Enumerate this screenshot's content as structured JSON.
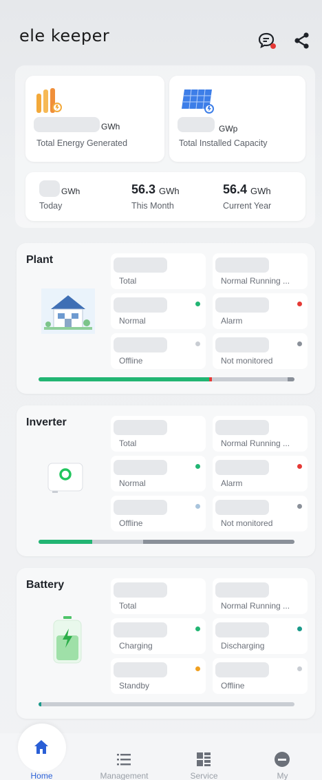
{
  "app": {
    "logo_text": "ele keeper"
  },
  "header": {
    "message_icon": "chat-alert-icon",
    "share_icon": "share-icon"
  },
  "summary": {
    "total_energy": {
      "unit": "GWh",
      "label": "Total Energy Generated"
    },
    "installed_capacity": {
      "unit": "GWp",
      "label": "Total Installed Capacity"
    },
    "today": {
      "unit": "GWh",
      "label": "Today"
    },
    "this_month": {
      "value": "56.3",
      "unit": "GWh",
      "label": "This Month"
    },
    "current_year": {
      "value": "56.4",
      "unit": "GWh",
      "label": "Current Year"
    }
  },
  "plant": {
    "title": "Plant",
    "cells": [
      "Total",
      "Normal Running ...",
      "Normal",
      "Alarm",
      "Offline",
      "Not monitored"
    ],
    "progress": {
      "normal": 0.67,
      "alarm": 0.01,
      "offline": 0.27,
      "not_monitored": 0.02
    }
  },
  "inverter": {
    "title": "Inverter",
    "cells": [
      "Total",
      "Normal Running ...",
      "Normal",
      "Alarm",
      "Offline",
      "Not monitored"
    ],
    "progress": {
      "normal": 0.21,
      "offline": 0.2,
      "not_monitored": 0.59
    }
  },
  "battery": {
    "title": "Battery",
    "cells": [
      "Total",
      "Normal Running ...",
      "Charging",
      "Discharging",
      "Standby",
      "Offline"
    ],
    "progress": {
      "charging": 0.01
    }
  },
  "colors": {
    "normal": "#22b573",
    "alarm": "#e53935",
    "offline": "#c9cdd3",
    "not_monitored": "#8a9099",
    "teal": "#1a9a8a",
    "standby": "#f0a020",
    "accent": "#2a5fd6"
  },
  "tabs": [
    {
      "label": "Home",
      "icon": "home-icon"
    },
    {
      "label": "Management",
      "icon": "list-icon"
    },
    {
      "label": "Service",
      "icon": "grid-icon"
    },
    {
      "label": "My",
      "icon": "profile-icon"
    }
  ]
}
